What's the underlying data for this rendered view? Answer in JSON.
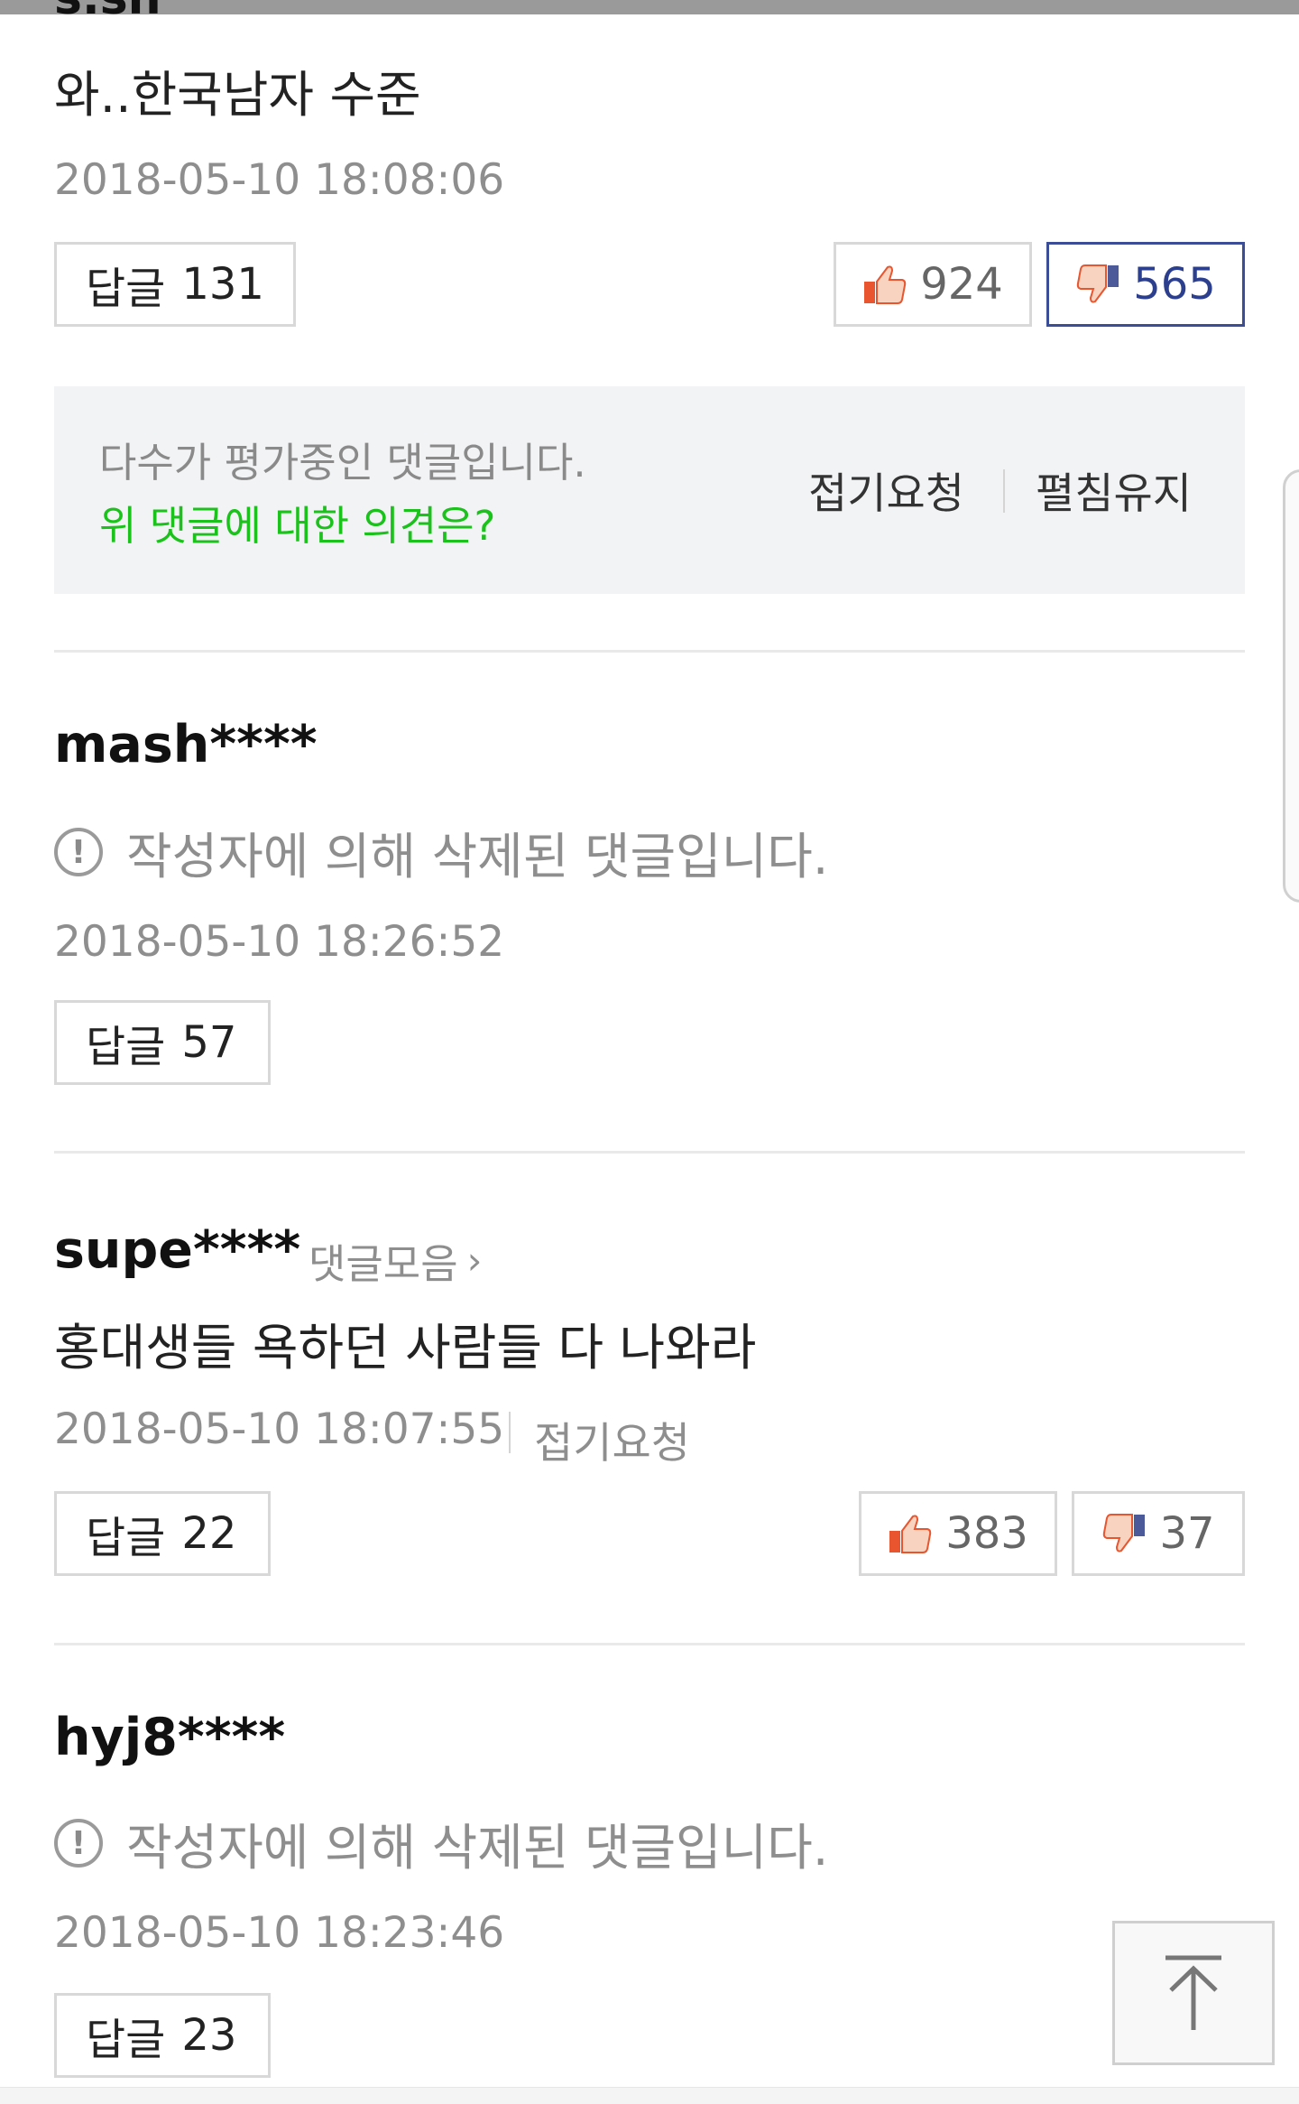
{
  "comments": [
    {
      "text": "와..한국남자 수준",
      "date": "2018-05-10 18:08:06",
      "reply_label": "답글",
      "reply_count": "131",
      "likes": "924",
      "dislikes": "565",
      "dislike_active": true
    },
    {
      "username": "mash****",
      "deleted_text": "작성자에 의해 삭제된 댓글입니다.",
      "date": "2018-05-10 18:26:52",
      "reply_label": "답글",
      "reply_count": "57"
    },
    {
      "username": "supe****",
      "collect_label": "댓글모음",
      "text": "홍대생들 욕하던 사람들 다 나와라",
      "date": "2018-05-10 18:07:55",
      "fold_label": "접기요청",
      "reply_label": "답글",
      "reply_count": "22",
      "likes": "383",
      "dislikes": "37"
    },
    {
      "username": "hyj8****",
      "deleted_text": "작성자에 의해 삭제된 댓글입니다.",
      "date": "2018-05-10 18:23:46",
      "reply_label": "답글",
      "reply_count": "23"
    }
  ],
  "notice": {
    "line1": "다수가 평가중인 댓글입니다.",
    "line2": "위 댓글에 대한 의견은?",
    "fold_request": "접기요청",
    "keep_open": "펼침유지"
  },
  "icons": {
    "like": "thumbs-up-icon",
    "dislike": "thumbs-down-icon",
    "warning": "exclamation-circle-icon",
    "scroll_top": "arrow-up-icon"
  },
  "colors": {
    "accent_green": "#1bc21b",
    "active_dislike": "#2c3f8f",
    "muted_text": "#8e8e8e"
  }
}
